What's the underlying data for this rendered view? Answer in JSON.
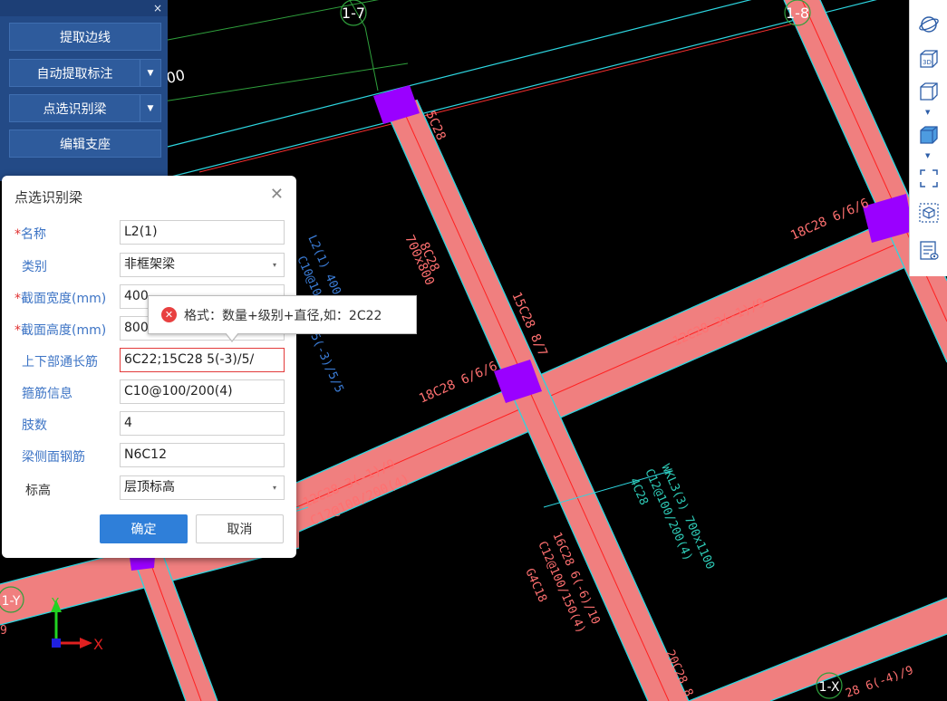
{
  "canvas": {
    "axes": [
      "1-7",
      "1-8",
      "1-Y",
      "1-X"
    ],
    "labels": [
      {
        "text": "00",
        "color": "#ffffff"
      },
      {
        "text": "5C28",
        "color": "#ff7070"
      },
      {
        "text": "8C28",
        "color": "#ff7070"
      },
      {
        "text": "700x800",
        "color": "#ff7070"
      },
      {
        "text": "15C28 8/7",
        "color": "#ff7070"
      },
      {
        "text": "18C28 6/6/6",
        "color": "#ff7070"
      },
      {
        "text": "12C28 3(-1)/9",
        "color": "#ff7070"
      },
      {
        "text": "18C28 6/6/6",
        "color": "#ff7070"
      },
      {
        "text": "12C28 3(-1)/9",
        "color": "#ff7070"
      },
      {
        "text": "C12@100/200(4)",
        "color": "#ff7070"
      },
      {
        "text": "WKL3(3) 700x1100",
        "color": "#2ecbb7"
      },
      {
        "text": "C12@100/200(4)",
        "color": "#2ecbb7"
      },
      {
        "text": "4C28",
        "color": "#2ecbb7"
      },
      {
        "text": "16C28 6(-6)/10",
        "color": "#ff7070"
      },
      {
        "text": "C12@100/150(4)",
        "color": "#ff7070"
      },
      {
        "text": "G4C18",
        "color": "#ff7070"
      },
      {
        "text": "20C28 8",
        "color": "#ff7070"
      },
      {
        "text": "28 6(-4)/9",
        "color": "#ff7070"
      },
      {
        "text": "L2(1) 400",
        "color": "#3b7dd8"
      },
      {
        "text": "C10@100",
        "color": "#3b7dd8"
      },
      {
        "text": "5(-3)/5/5",
        "color": "#3b7dd8"
      },
      {
        "text": "9",
        "color": "#ff7070"
      }
    ],
    "coord_x": "X",
    "coord_y": "Y"
  },
  "tool_panel": {
    "close": "×",
    "buttons": [
      {
        "label": "提取边线",
        "dropdown": false
      },
      {
        "label": "自动提取标注",
        "dropdown": true
      },
      {
        "label": "点选识别梁",
        "dropdown": true
      },
      {
        "label": "编辑支座",
        "dropdown": false
      }
    ],
    "caret": "▼"
  },
  "dialog": {
    "title": "点选识别梁",
    "close": "✕",
    "required_mark": "*",
    "fields": [
      {
        "label": "名称",
        "required": true,
        "value": "L2(1)",
        "type": "text"
      },
      {
        "label": "类别",
        "required": false,
        "value": "非框架梁",
        "type": "select"
      },
      {
        "label": "截面宽度(mm)",
        "required": true,
        "value": "400",
        "type": "text"
      },
      {
        "label": "截面高度(mm)",
        "required": true,
        "value": "800",
        "type": "text"
      },
      {
        "label": "上下部通长筋",
        "required": false,
        "value": "6C22;15C28 5(-3)/5/",
        "type": "text",
        "error": true
      },
      {
        "label": "箍筋信息",
        "required": false,
        "value": "C10@100/200(4)",
        "type": "text"
      },
      {
        "label": "肢数",
        "required": false,
        "value": "4",
        "type": "text"
      },
      {
        "label": "梁侧面钢筋",
        "required": false,
        "value": "N6C12",
        "type": "text"
      },
      {
        "label": "标高",
        "required": false,
        "value": "层顶标高",
        "type": "select",
        "plain": true
      }
    ],
    "ok": "确定",
    "cancel": "取消",
    "select_caret": "▾"
  },
  "tooltip": {
    "icon": "✕",
    "text": "格式：数量+级别+直径,如：2C22"
  },
  "right_toolbar": {
    "tools": [
      "orbit-icon",
      "3d-view-icon",
      "cube-outline-icon",
      "cube-shaded-icon",
      "fullscreen-icon",
      "zoom-extents-icon",
      "view-properties-icon"
    ],
    "label_3d": "3D",
    "caret": "▼"
  }
}
